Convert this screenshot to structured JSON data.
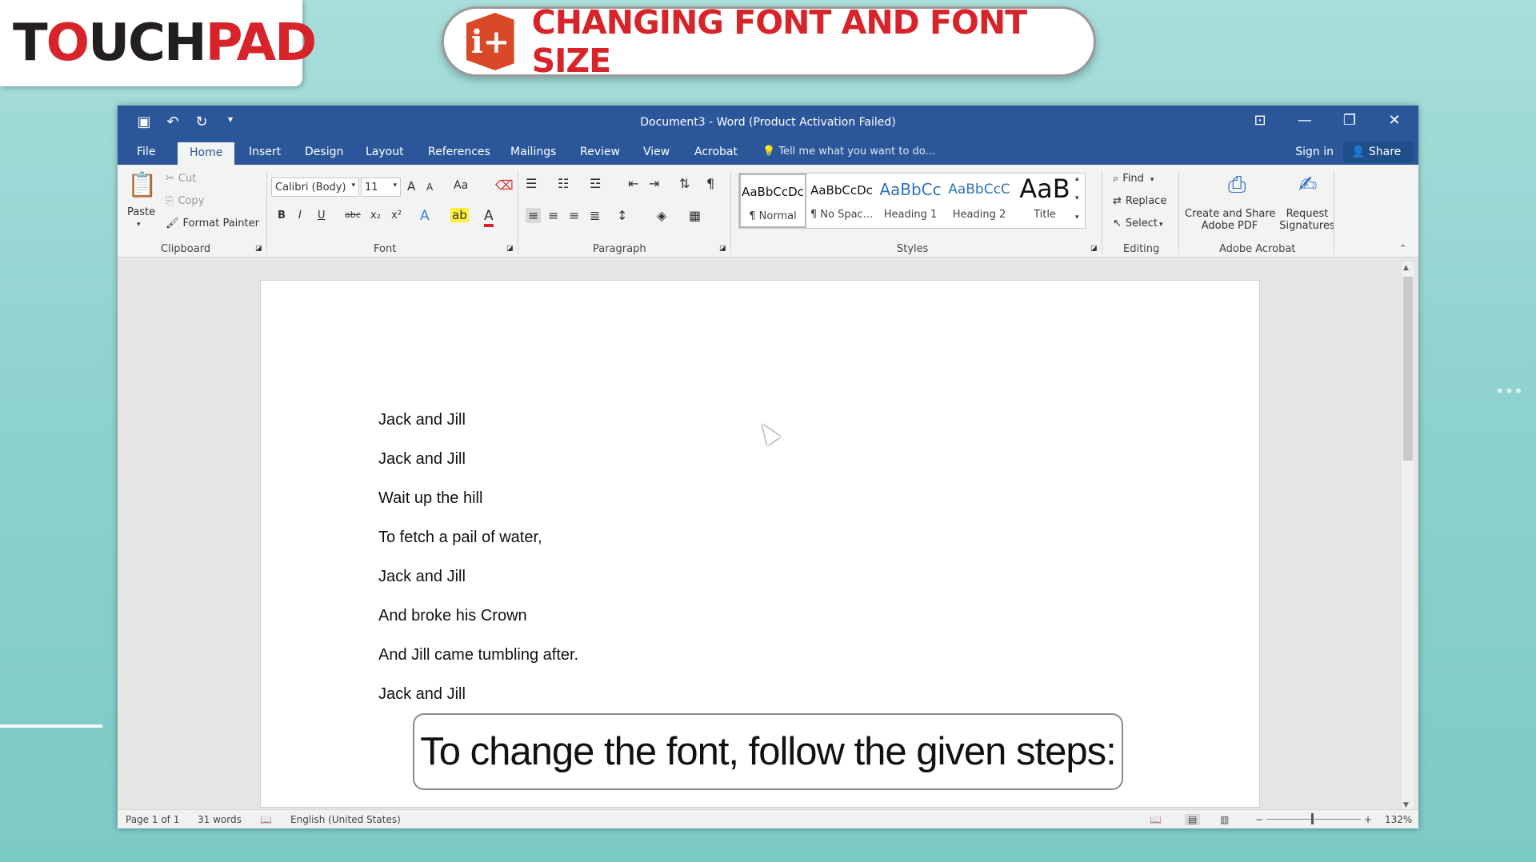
{
  "brand": {
    "logo_t": "T",
    "logo_o": "O",
    "logo_uch": "UCH",
    "logo_pad": "PAD"
  },
  "banner": {
    "icon": "i+",
    "title": "CHANGING FONT AND FONT SIZE"
  },
  "window": {
    "title": "Document3 - Word (Product Activation Failed)",
    "tabs": [
      "File",
      "Home",
      "Insert",
      "Design",
      "Layout",
      "References",
      "Mailings",
      "Review",
      "View",
      "Acrobat"
    ],
    "active_tab": "Home",
    "tell_me": "Tell me what you want to do...",
    "sign_in": "Sign in",
    "share": "Share"
  },
  "ribbon": {
    "clipboard": {
      "paste": "Paste",
      "cut": "Cut",
      "copy": "Copy",
      "format_painter": "Format Painter",
      "label": "Clipboard"
    },
    "font": {
      "font_name": "Calibri (Body)",
      "font_size": "11",
      "label": "Font",
      "grow": "A",
      "shrink": "A",
      "case": "Aa"
    },
    "paragraph": {
      "label": "Paragraph"
    },
    "styles": {
      "label": "Styles",
      "items": [
        {
          "sample": "AaBbCcDc",
          "name": "¶ Normal"
        },
        {
          "sample": "AaBbCcDc",
          "name": "¶ No Spac..."
        },
        {
          "sample": "AaBbCc",
          "name": "Heading 1"
        },
        {
          "sample": "AaBbCcC",
          "name": "Heading 2"
        },
        {
          "sample": "AaB",
          "name": "Title"
        }
      ]
    },
    "editing": {
      "find": "Find",
      "replace": "Replace",
      "select": "Select",
      "label": "Editing"
    },
    "acrobat": {
      "create_line1": "Create and Share",
      "create_line2": "Adobe PDF",
      "request_line1": "Request",
      "request_line2": "Signatures",
      "label": "Adobe Acrobat"
    }
  },
  "document": {
    "lines": [
      "Jack and Jill",
      "Jack and Jill",
      "Wait up the hill",
      "To fetch a pail of water,",
      "Jack and Jill",
      "And broke his Crown",
      "And Jill came tumbling after.",
      "Jack and Jill"
    ]
  },
  "status": {
    "page": "Page 1 of 1",
    "words": "31 words",
    "language": "English (United States)",
    "zoom": "132%"
  },
  "caption": "To change the font, follow the given steps:"
}
